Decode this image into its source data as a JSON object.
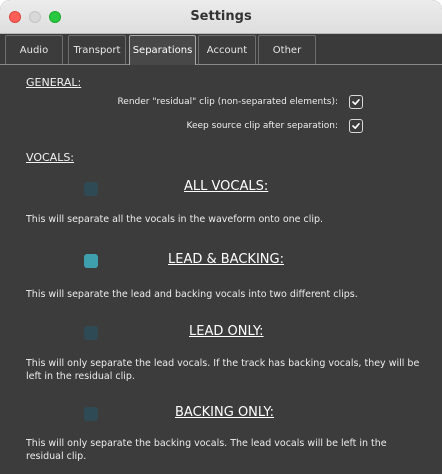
{
  "window": {
    "title": "Settings"
  },
  "tabs": [
    {
      "label": "Audio",
      "active": false
    },
    {
      "label": "Transport",
      "active": false
    },
    {
      "label": "Separations",
      "active": true
    },
    {
      "label": "Account",
      "active": false
    },
    {
      "label": "Other",
      "active": false
    }
  ],
  "general": {
    "heading": "GENERAL:",
    "render_residual_label": "Render \"residual\" clip (non-separated elements):",
    "render_residual_checked": true,
    "keep_source_label": "Keep source clip after separation:",
    "keep_source_checked": true
  },
  "vocals": {
    "heading": "VOCALS:",
    "options": [
      {
        "title": "ALL VOCALS:",
        "description": "This will separate all the vocals in the waveform onto one clip.",
        "selected": false
      },
      {
        "title": "LEAD & BACKING:",
        "description": "This will separate the lead and backing vocals into two different clips.",
        "selected": true
      },
      {
        "title": "LEAD ONLY:",
        "description": "This will only separate the lead vocals. If the track has backing vocals, they will be left in the residual clip.",
        "selected": false
      },
      {
        "title": "BACKING ONLY:",
        "description": "This will only separate the backing vocals. The lead vocals will be left in the residual clip.",
        "selected": false
      }
    ]
  },
  "colors": {
    "background": "#3c3c3c",
    "radio_selected": "#3fa0ad",
    "radio_unselected": "#2e4a55"
  }
}
